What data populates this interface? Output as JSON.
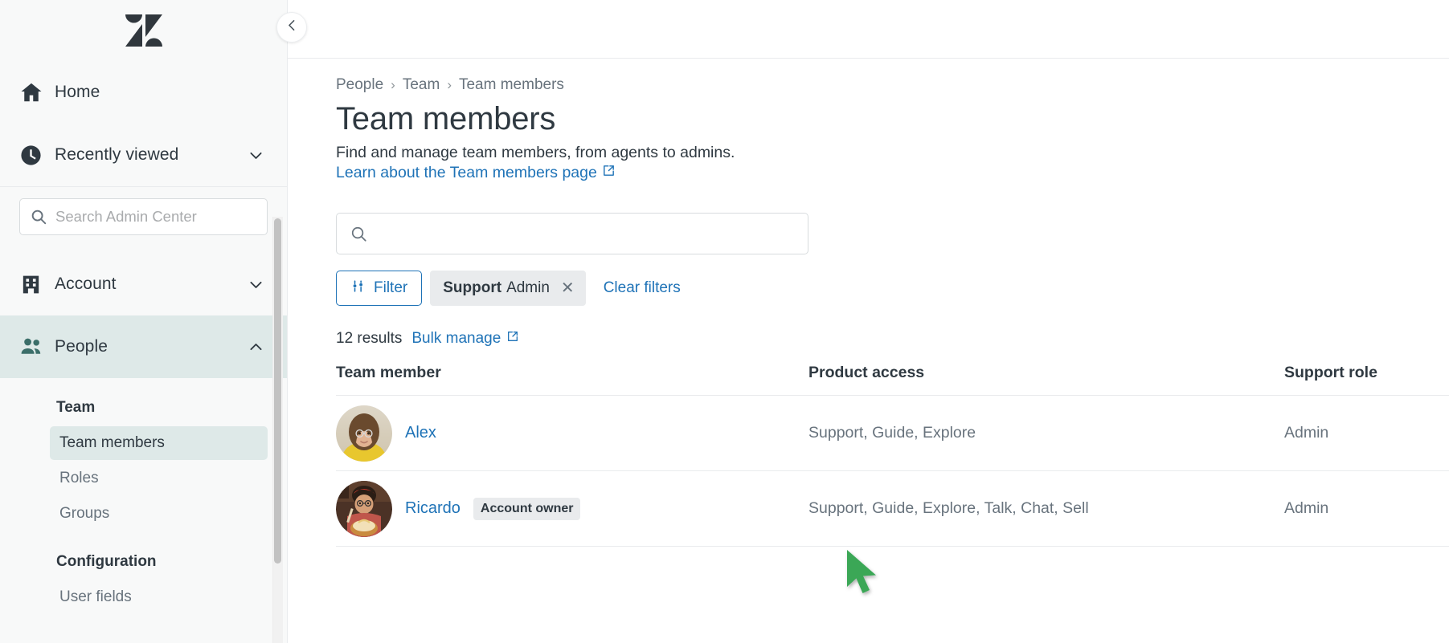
{
  "brand": {
    "logo_name": "zendesk-logo"
  },
  "sidebar": {
    "primary": [
      {
        "id": "home",
        "label": "Home",
        "icon": "home-icon",
        "chevron": null
      },
      {
        "id": "recently-viewed",
        "label": "Recently viewed",
        "icon": "clock-icon",
        "chevron": "chevron-down-icon"
      }
    ],
    "search": {
      "placeholder": "Search Admin Center",
      "value": "",
      "icon": "search-icon"
    },
    "sections": [
      {
        "id": "account",
        "label": "Account",
        "icon": "building-icon",
        "chevron": "chevron-down-icon",
        "expanded": false
      },
      {
        "id": "people",
        "label": "People",
        "icon": "people-icon",
        "chevron": "chevron-up-icon",
        "expanded": true
      }
    ],
    "people_group_title": "Team",
    "people_items": [
      {
        "id": "team-members",
        "label": "Team members",
        "selected": true
      },
      {
        "id": "roles",
        "label": "Roles",
        "selected": false
      },
      {
        "id": "groups",
        "label": "Groups",
        "selected": false
      }
    ],
    "configuration_title": "Configuration",
    "configuration_items": [
      {
        "id": "user-fields",
        "label": "User fields",
        "selected": false
      }
    ],
    "collapse_button": {
      "icon": "chevron-left-icon",
      "label": "Collapse navigation"
    }
  },
  "breadcrumb": [
    {
      "label": "People"
    },
    {
      "label": "Team"
    },
    {
      "label": "Team members"
    }
  ],
  "page": {
    "title": "Team members",
    "subtitle": "Find and manage team members, from agents to admins.",
    "learn_link": "Learn about the Team members page",
    "learn_link_icon": "external-link-icon"
  },
  "search": {
    "placeholder": "",
    "value": "",
    "icon": "search-icon"
  },
  "filters": {
    "filter_button": {
      "label": "Filter",
      "icon": "filter-sliders-icon"
    },
    "chips": [
      {
        "key": "Support",
        "value": "Admin",
        "remove_icon": "close-icon"
      }
    ],
    "clear_label": "Clear filters"
  },
  "results": {
    "count_label": "12 results",
    "bulk_manage": "Bulk manage",
    "bulk_manage_icon": "external-link-icon"
  },
  "table": {
    "columns": [
      "Team member",
      "Product access",
      "Support role"
    ],
    "rows": [
      {
        "name": "Alex",
        "badge": null,
        "avatar": "avatar-alex",
        "product_access": "Support, Guide, Explore",
        "support_role": "Admin"
      },
      {
        "name": "Ricardo",
        "badge": "Account owner",
        "avatar": "avatar-ricardo",
        "product_access": "Support, Guide, Explore, Talk, Chat, Sell",
        "support_role": "Admin"
      }
    ]
  },
  "cursor": {
    "name": "mouse-cursor",
    "color": "#3aa757"
  },
  "colors": {
    "link": "#1f73b7",
    "sidebar_bg": "#f8f9f9",
    "active_nav_bg": "#dee9e8",
    "text": "#2f3941",
    "muted": "#68737d",
    "border": "#e9ebed",
    "chip_bg": "#e9ebed"
  }
}
